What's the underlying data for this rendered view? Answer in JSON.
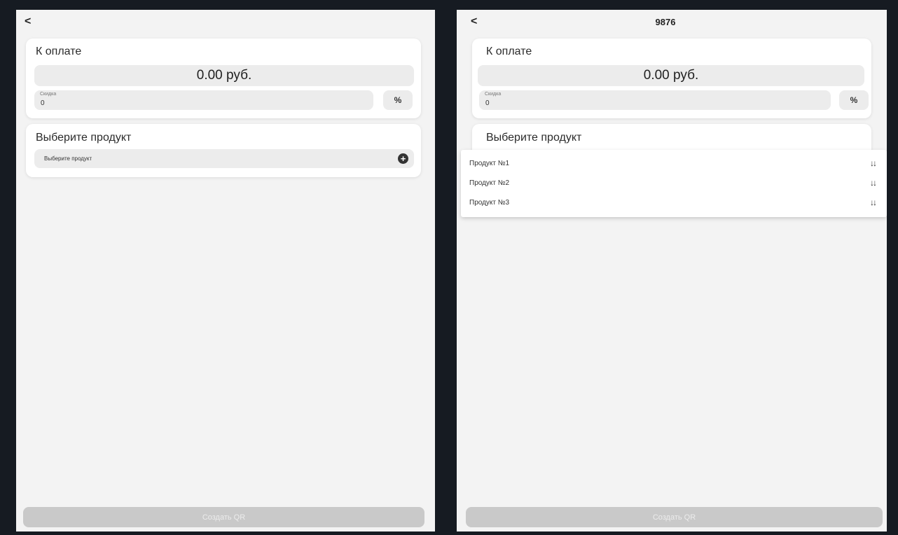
{
  "left_screen": {
    "back_icon": "<",
    "payment": {
      "title": "К оплате",
      "amount": "0.00 руб.",
      "discount_label": "Скидка",
      "discount_value": "0",
      "percent_label": "%"
    },
    "product": {
      "title": "Выберите продукт",
      "select_label": "Выберите продукт",
      "add_icon": "plus-circle-icon"
    },
    "create_qr_label": "Создать QR"
  },
  "right_screen": {
    "back_icon": "<",
    "title": "9876",
    "payment": {
      "title": "К оплате",
      "amount": "0.00 руб.",
      "discount_label": "Скидка",
      "discount_value": "0",
      "percent_label": "%"
    },
    "product": {
      "title": "Выберите продукт"
    },
    "dropdown_items": [
      {
        "label": "Продукт №1",
        "icon": "sort-arrows-icon"
      },
      {
        "label": "Продукт №2",
        "icon": "sort-arrows-icon"
      },
      {
        "label": "Продукт №3",
        "icon": "sort-arrows-icon"
      }
    ],
    "create_qr_label": "Создать QR"
  },
  "colors": {
    "frame_background": "#161b22",
    "screen_background": "#f3f3f3",
    "card_background": "#ffffff",
    "field_background": "#ececec",
    "disabled_button": "#c9c9c9"
  }
}
